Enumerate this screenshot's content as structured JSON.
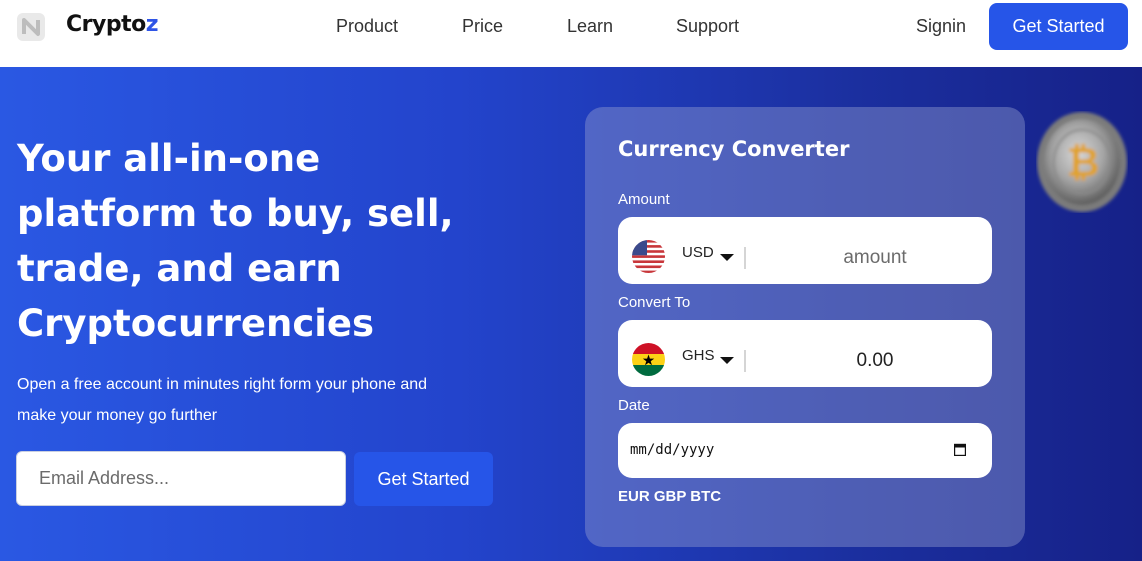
{
  "brand": {
    "name_main": "Crypto",
    "name_accent": "z",
    "accent_color": "#2f55e6"
  },
  "nav": {
    "links": [
      "Product",
      "Price",
      "Learn",
      "Support"
    ],
    "signin": "Signin",
    "cta": "Get Started"
  },
  "hero": {
    "headline_lines": [
      "Your all-in-one",
      "platform to buy, sell,",
      "trade, and earn",
      "Cryptocurrencies"
    ],
    "subtext_lines": [
      "Open a free account in minutes right form your phone and",
      "make your money go further"
    ],
    "email_placeholder": "Email Address...",
    "cta": "Get Started"
  },
  "converter": {
    "title": "Currency Converter",
    "amount_label": "Amount",
    "from_currency": "USD",
    "amount_placeholder": "amount",
    "convert_label": "Convert To",
    "to_currency": "GHS",
    "converted_value": "0.00",
    "date_label": "Date",
    "date_placeholder": "mm/dd/yyyy",
    "currency_list": "EUR GBP BTC"
  },
  "icons": {
    "logo": "brand-logo-icon",
    "from_flag": "us-flag-icon",
    "to_flag": "ghana-flag-icon",
    "calendar": "calendar-icon",
    "coin": "bitcoin-coin-icon"
  },
  "colors": {
    "primary_button": "#2655e8",
    "hero_start": "#2a58e3",
    "hero_end": "#162188"
  }
}
